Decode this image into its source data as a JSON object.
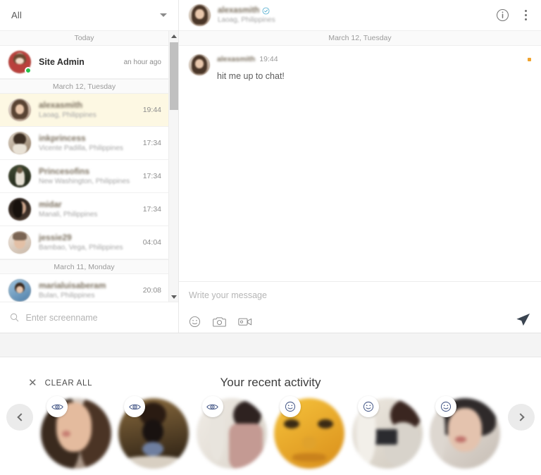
{
  "sidebar": {
    "filter": {
      "label": "All",
      "caret_icon": "chevron-down-icon"
    },
    "search": {
      "placeholder": "Enter screenname",
      "icon": "search-icon",
      "value": ""
    },
    "groups": [
      {
        "label": "Today"
      },
      {
        "label": "March 12, Tuesday"
      },
      {
        "label": "March 11, Monday"
      }
    ],
    "conversations": [
      {
        "name": "Site Admin",
        "location": "",
        "time": "an hour ago",
        "online": true,
        "selected": false,
        "blurred": false,
        "group": "Today"
      },
      {
        "name": "alexasmith",
        "location": "Laoag, Philippines",
        "time": "19:44",
        "online": false,
        "selected": true,
        "blurred": true,
        "group": "March 12, Tuesday"
      },
      {
        "name": "inkprincess",
        "location": "Vicente Padilla, Philippines",
        "time": "17:34",
        "online": false,
        "selected": false,
        "blurred": true,
        "group": "March 12, Tuesday"
      },
      {
        "name": "Princesofins",
        "location": "New Washington, Philippines",
        "time": "17:34",
        "online": false,
        "selected": false,
        "blurred": true,
        "group": "March 12, Tuesday"
      },
      {
        "name": "midar",
        "location": "Manali, Philippines",
        "time": "17:34",
        "online": false,
        "selected": false,
        "blurred": true,
        "group": "March 12, Tuesday"
      },
      {
        "name": "jessie29",
        "location": "Bambao, Vega, Philippines",
        "time": "04:04",
        "online": false,
        "selected": false,
        "blurred": true,
        "group": "March 12, Tuesday"
      },
      {
        "name": "marialuisaberam",
        "location": "Bulan, Philippines",
        "time": "20:08",
        "online": false,
        "selected": false,
        "blurred": true,
        "group": "March 11, Monday"
      }
    ],
    "scrollbar": {
      "up_icon": "scroll-up-arrow-icon",
      "down_icon": "scroll-down-arrow-icon"
    }
  },
  "chat": {
    "header": {
      "name": "alexasmith",
      "location": "Laoag, Philippines",
      "verified_icon": "verified-check-icon",
      "info_icon": "info-circle-icon",
      "more_icon": "more-vertical-icon"
    },
    "day_divider": "March 12, Tuesday",
    "messages": [
      {
        "author": "alexasmith",
        "time": "19:44",
        "text": "hit me up to chat!",
        "status_color": "#f0a32e"
      }
    ],
    "composer": {
      "placeholder": "Write your message",
      "value": "",
      "emoji_icon": "emoji-smiley-icon",
      "camera_icon": "camera-icon",
      "video_icon": "video-camera-icon",
      "send_icon": "send-paper-plane-icon"
    }
  },
  "activity": {
    "title": "Your recent activity",
    "clear_all": {
      "label": "CLEAR ALL",
      "icon": "close-x-icon"
    },
    "prev_icon": "chevron-left-icon",
    "next_icon": "chevron-right-icon",
    "cards": [
      {
        "badge": "eye-icon"
      },
      {
        "badge": "eye-icon"
      },
      {
        "badge": "eye-icon"
      },
      {
        "badge": "smiley-icon"
      },
      {
        "badge": "smiley-icon"
      },
      {
        "badge": "smiley-icon"
      }
    ]
  },
  "colors": {
    "selected_row": "#fdf8e3",
    "online": "#27c24c",
    "status_dot": "#f0a32e",
    "page_bg": "#f4f4f4"
  }
}
